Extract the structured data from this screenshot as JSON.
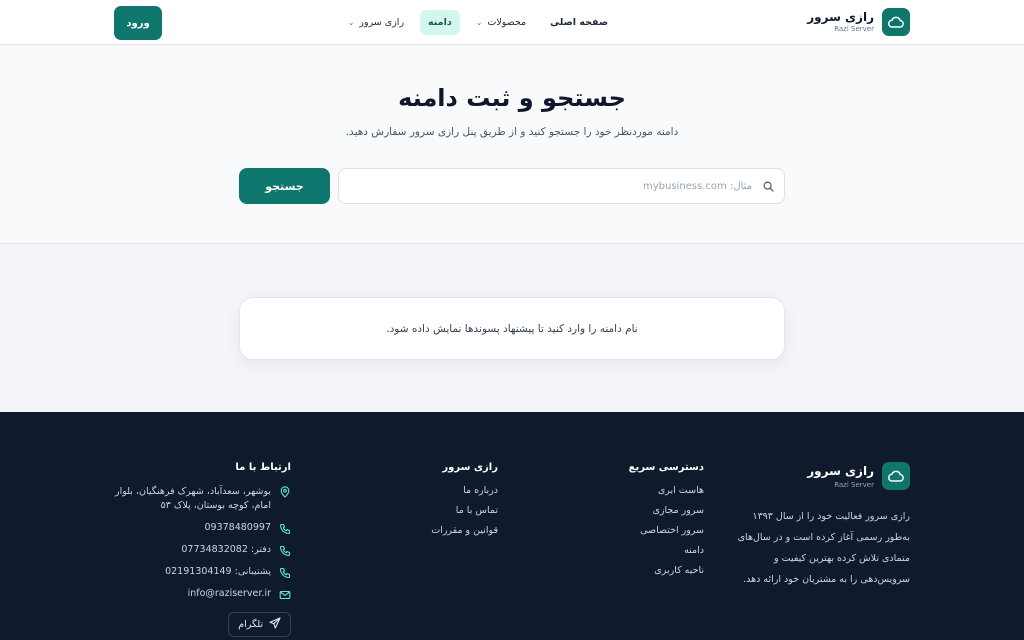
{
  "header": {
    "brand_title": "رازی سرور",
    "brand_subtitle": "Razi Server",
    "nav": {
      "home": "صفحه اصلی",
      "products": "محصولات",
      "domain": "دامنه",
      "razi_server": "رازی سرور"
    },
    "login_label": "ورود"
  },
  "hero": {
    "title": "جستجو و ثبت دامنه",
    "subtitle": "دامنه موردنظر خود را جستجو کنید و از طریق پنل رازی سرور سفارش دهید.",
    "search_placeholder": "مثال: mybusiness.com",
    "search_button": "جستجو"
  },
  "suggestions": {
    "message": "نام دامنه را وارد کنید تا پیشنهاد پسوندها نمایش داده شود."
  },
  "footer": {
    "brand_title": "رازی سرور",
    "brand_subtitle": "Razi Server",
    "about": "رازی سرور فعالیت خود را از سال ۱۳۹۳ به‌طور رسمی آغاز کرده است و در سال‌های متمادی تلاش کرده بهترین کیفیت و سرویس‌دهی را به مشتریان خود ارائه دهد.",
    "quick_access": {
      "heading": "دسترسی سریع",
      "links": [
        "هاست ابری",
        "سرور مجازی",
        "سرور اختصاصی",
        "دامنه",
        "ناحیه کاربری"
      ]
    },
    "razi": {
      "heading": "رازی سرور",
      "links": [
        "درباره ما",
        "تماس با ما",
        "قوانین و مقررات"
      ]
    },
    "contact": {
      "heading": "ارتباط با ما",
      "address": "بوشهر، سعدآباد، شهرک فرهنگیان، بلوار امام، کوچه بوستان، پلاک ۵۳",
      "mobile": "09378480997",
      "office": "دفتر: 07734832082",
      "support": "پشتیبانی: 02191304149",
      "email": "info@raziserver.ir",
      "telegram": "تلگرام"
    }
  },
  "colors": {
    "accent": "#0f766e",
    "active_nav_bg": "#d5f5ef",
    "footer_bg": "#0f1b2d"
  },
  "icons": {
    "logo": "cloud-icon",
    "search": "search-icon",
    "dropdown": "chevron-down-icon",
    "address": "map-pin-icon",
    "phone": "phone-icon",
    "email": "mail-icon",
    "telegram": "send-icon"
  }
}
